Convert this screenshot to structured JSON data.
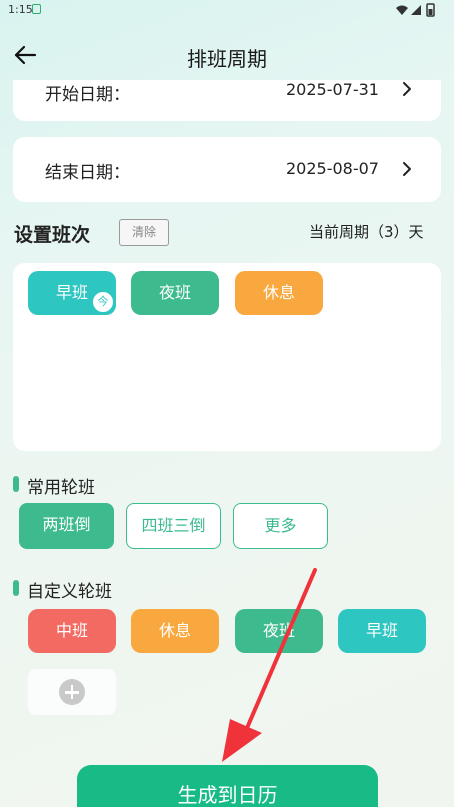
{
  "status_bar": {
    "time": "1:15"
  },
  "header": {
    "title": "排班周期"
  },
  "period": {
    "start_label": "开始日期：",
    "start_value": "2025-07-31",
    "end_label": "结束日期：",
    "end_value": "2025-08-07"
  },
  "shift_setup": {
    "title": "设置班次",
    "clear_label": "清除",
    "cycle_text": "当前周期（3）天",
    "today_badge": "今",
    "shifts": [
      "早班",
      "夜班",
      "休息"
    ]
  },
  "common_rotation": {
    "title": "常用轮班",
    "options": [
      "两班倒",
      "四班三倒",
      "更多"
    ],
    "selected": "两班倒"
  },
  "custom_rotation": {
    "title": "自定义轮班",
    "items": [
      "中班",
      "休息",
      "夜班",
      "早班"
    ]
  },
  "generate_button": "生成到日历",
  "colors": {
    "teal": "#2ec6c1",
    "green": "#3dbb8e",
    "orange": "#f8a83e",
    "red": "#f36a62",
    "primary_button": "#18bb86",
    "annotation_arrow": "#f0323a"
  }
}
